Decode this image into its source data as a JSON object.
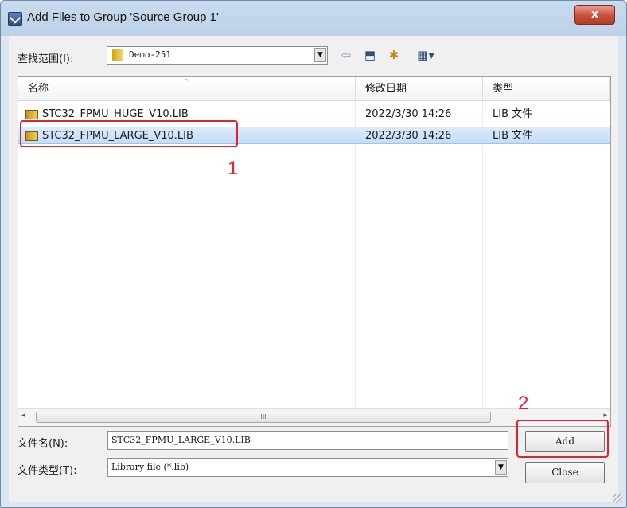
{
  "window": {
    "title": "Add Files to Group 'Source Group 1'",
    "close_glyph": "x"
  },
  "look_in": {
    "label": "查找范围(I):",
    "value": "Demo-251"
  },
  "toolbar": {
    "back_glyph": "⇦",
    "up_glyph": "⬒",
    "new_folder_glyph": "✱",
    "view_glyph": "▦▾"
  },
  "file_list": {
    "columns": [
      "名称",
      "修改日期",
      "类型"
    ],
    "rows": [
      {
        "name": "STC32_FPMU_HUGE_V10.LIB",
        "date": "2022/3/30 14:26",
        "type": "LIB 文件",
        "selected": false
      },
      {
        "name": "STC32_FPMU_LARGE_V10.LIB",
        "date": "2022/3/30 14:26",
        "type": "LIB 文件",
        "selected": true
      }
    ],
    "sort_glyph": "^",
    "scroll_left_glyph": "◂",
    "scroll_thumb_glyph": "III",
    "scroll_right_glyph": "▸"
  },
  "file_name": {
    "label": "文件名(N):",
    "value": "STC32_FPMU_LARGE_V10.LIB"
  },
  "file_type": {
    "label": "文件类型(T):",
    "value": "Library file (*.lib)"
  },
  "buttons": {
    "add": "Add",
    "close": "Close"
  },
  "annotations": {
    "marker_1": "1",
    "marker_2": "2"
  },
  "colors": {
    "annotation_red": "#e2222c",
    "selection_blue": "#c4dcf6"
  }
}
